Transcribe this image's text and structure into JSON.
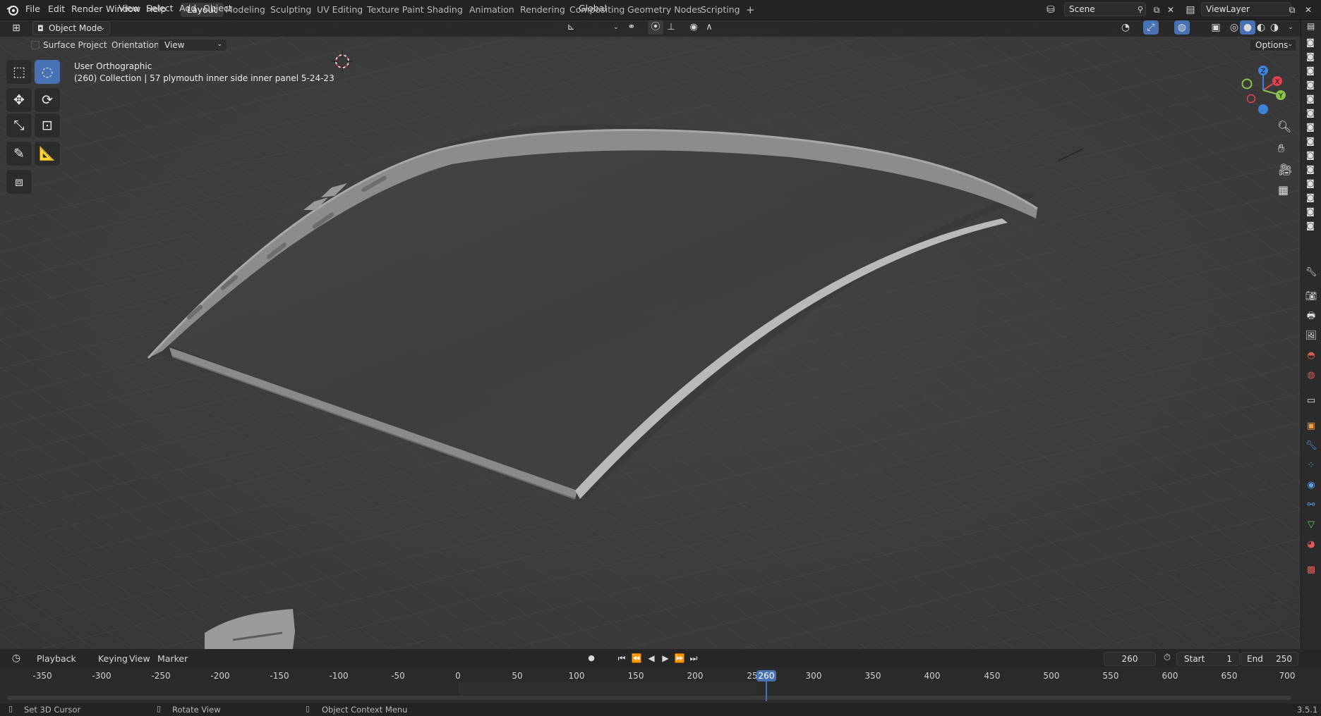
{
  "menu": [
    "File",
    "Edit",
    "Render",
    "Window",
    "Help"
  ],
  "workspaces": [
    "Layout",
    "Modeling",
    "Sculpting",
    "UV Editing",
    "Texture Paint",
    "Shading",
    "Animation",
    "Rendering",
    "Compositing",
    "Geometry Nodes",
    "Scripting"
  ],
  "active_workspace": "Layout",
  "add_workspace": "+",
  "scene": "Scene",
  "view_layer": "ViewLayer",
  "header": {
    "mode": "Object Mode",
    "menus": [
      "View",
      "Select",
      "Add",
      "Object"
    ],
    "transform_orientation": "Global",
    "options": "Options"
  },
  "tool_settings": {
    "surface_project_label": "Surface Project",
    "orientation_label": "Orientation:",
    "orientation_value": "View"
  },
  "viewport_info": {
    "view_name": "User Orthographic",
    "object_info": "(260) Collection | 57 plymouth  inner side inner panel 5-24-23"
  },
  "gizmo": {
    "x": "X",
    "y": "Y",
    "z": "Z"
  },
  "timeline": {
    "menus": [
      "Playback",
      "Keying",
      "View",
      "Marker"
    ],
    "current_frame": "260",
    "start_label": "Start",
    "start_value": "1",
    "end_label": "End",
    "end_value": "250",
    "ruler": [
      "-350",
      "-300",
      "-250",
      "-200",
      "-150",
      "-100",
      "-50",
      "0",
      "50",
      "100",
      "150",
      "200",
      "25",
      "300",
      "350",
      "400",
      "450",
      "500",
      "550",
      "600",
      "650",
      "700"
    ],
    "playhead_label": "260"
  },
  "statusbar": {
    "left": "Set 3D Cursor",
    "middle": "Rotate View",
    "right": "Object Context Menu",
    "version": "3.5.1"
  },
  "colors": {
    "accent": "#4772b3",
    "axis_x": "#e0404f",
    "axis_y": "#8bc34a",
    "axis_z": "#3d84d8"
  }
}
